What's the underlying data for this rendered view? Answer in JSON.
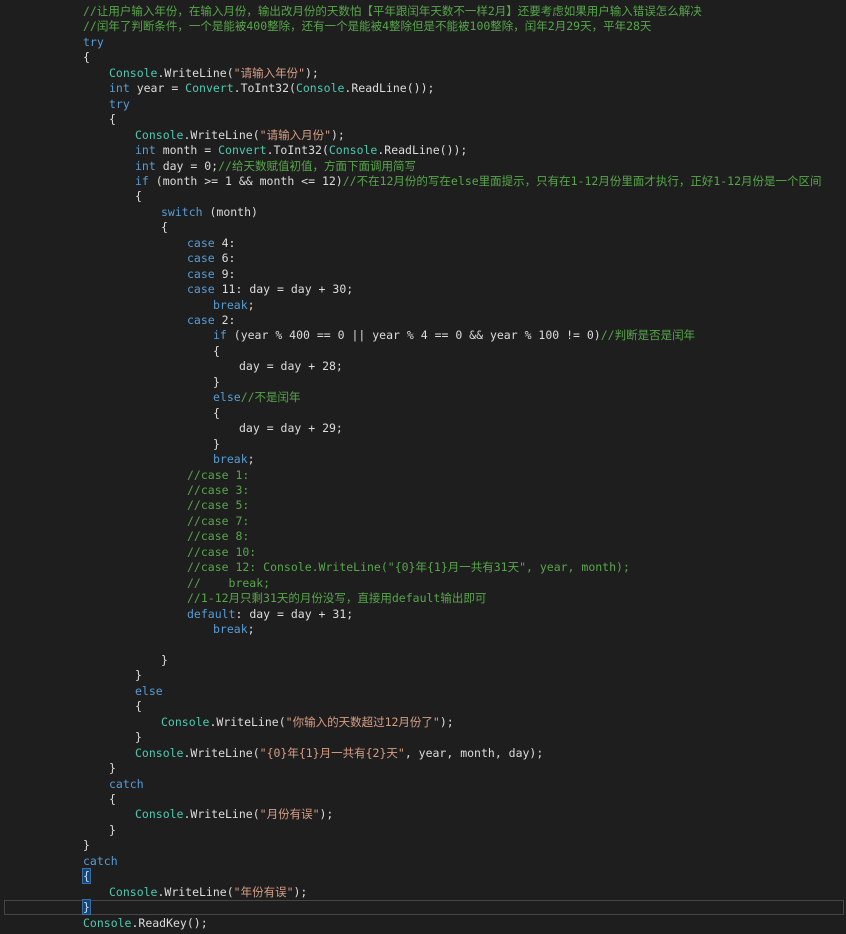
{
  "editor": {
    "colors": {
      "background": "#1e1e1e",
      "keyword": "#569cd6",
      "string": "#d69d85",
      "comment": "#57a64a",
      "type": "#4ec9b0",
      "text": "#dcdcdc",
      "brace_highlight": "#0e4583",
      "current_line_border": "#464646"
    },
    "lines": [
      {
        "indent": 12,
        "tokens": [
          {
            "t": "cm",
            "v": "//让用户输入年份，在输入月份，输出改月份的天数怕【平年跟闰年天数不一样2月】还要考虑如果用户输入错误怎么解决"
          }
        ]
      },
      {
        "indent": 12,
        "tokens": [
          {
            "t": "cm",
            "v": "//闰年了判断条件，一个是能被400整除，还有一个是能被4整除但是不能被100整除，闰年2月29天，平年28天"
          }
        ]
      },
      {
        "indent": 12,
        "tokens": [
          {
            "t": "kw",
            "v": "try"
          }
        ]
      },
      {
        "indent": 12,
        "tokens": [
          {
            "t": "pl",
            "v": "{"
          }
        ]
      },
      {
        "indent": 16,
        "tokens": [
          {
            "t": "ty",
            "v": "Console"
          },
          {
            "t": "pl",
            "v": ".WriteLine("
          },
          {
            "t": "str",
            "v": "\"请输入年份\""
          },
          {
            "t": "pl",
            "v": ");"
          }
        ]
      },
      {
        "indent": 16,
        "tokens": [
          {
            "t": "kw",
            "v": "int"
          },
          {
            "t": "pl",
            "v": " year = "
          },
          {
            "t": "ty",
            "v": "Convert"
          },
          {
            "t": "pl",
            "v": ".ToInt32("
          },
          {
            "t": "ty",
            "v": "Console"
          },
          {
            "t": "pl",
            "v": ".ReadLine());"
          }
        ]
      },
      {
        "indent": 16,
        "tokens": [
          {
            "t": "kw",
            "v": "try"
          }
        ]
      },
      {
        "indent": 16,
        "tokens": [
          {
            "t": "pl",
            "v": "{"
          }
        ]
      },
      {
        "indent": 20,
        "tokens": [
          {
            "t": "ty",
            "v": "Console"
          },
          {
            "t": "pl",
            "v": ".WriteLine("
          },
          {
            "t": "str",
            "v": "\"请输入月份\""
          },
          {
            "t": "pl",
            "v": ");"
          }
        ]
      },
      {
        "indent": 20,
        "tokens": [
          {
            "t": "kw",
            "v": "int"
          },
          {
            "t": "pl",
            "v": " month = "
          },
          {
            "t": "ty",
            "v": "Convert"
          },
          {
            "t": "pl",
            "v": ".ToInt32("
          },
          {
            "t": "ty",
            "v": "Console"
          },
          {
            "t": "pl",
            "v": ".ReadLine());"
          }
        ]
      },
      {
        "indent": 20,
        "tokens": [
          {
            "t": "kw",
            "v": "int"
          },
          {
            "t": "pl",
            "v": " day = 0;"
          },
          {
            "t": "cm",
            "v": "//给天数赋值初值，方面下面调用简写"
          }
        ]
      },
      {
        "indent": 20,
        "tokens": [
          {
            "t": "kw",
            "v": "if"
          },
          {
            "t": "pl",
            "v": " (month >= 1 && month <= 12)"
          },
          {
            "t": "cm",
            "v": "//不在12月份的写在else里面提示，只有在1-12月份里面才执行，正好1-12月份是一个区间"
          }
        ]
      },
      {
        "indent": 20,
        "tokens": [
          {
            "t": "pl",
            "v": "{"
          }
        ]
      },
      {
        "indent": 24,
        "tokens": [
          {
            "t": "kw",
            "v": "switch"
          },
          {
            "t": "pl",
            "v": " (month)"
          }
        ]
      },
      {
        "indent": 24,
        "tokens": [
          {
            "t": "pl",
            "v": "{"
          }
        ]
      },
      {
        "indent": 28,
        "tokens": [
          {
            "t": "kw",
            "v": "case"
          },
          {
            "t": "pl",
            "v": " 4:"
          }
        ]
      },
      {
        "indent": 28,
        "tokens": [
          {
            "t": "kw",
            "v": "case"
          },
          {
            "t": "pl",
            "v": " 6:"
          }
        ]
      },
      {
        "indent": 28,
        "tokens": [
          {
            "t": "kw",
            "v": "case"
          },
          {
            "t": "pl",
            "v": " 9:"
          }
        ]
      },
      {
        "indent": 28,
        "tokens": [
          {
            "t": "kw",
            "v": "case"
          },
          {
            "t": "pl",
            "v": " 11: day = day + 30;"
          }
        ]
      },
      {
        "indent": 32,
        "tokens": [
          {
            "t": "kw",
            "v": "break"
          },
          {
            "t": "pl",
            "v": ";"
          }
        ]
      },
      {
        "indent": 28,
        "tokens": [
          {
            "t": "kw",
            "v": "case"
          },
          {
            "t": "pl",
            "v": " 2:"
          }
        ]
      },
      {
        "indent": 32,
        "tokens": [
          {
            "t": "kw",
            "v": "if"
          },
          {
            "t": "pl",
            "v": " (year % 400 == 0 || year % 4 == 0 && year % 100 != 0)"
          },
          {
            "t": "cm",
            "v": "//判断是否是闰年"
          }
        ]
      },
      {
        "indent": 32,
        "tokens": [
          {
            "t": "pl",
            "v": "{"
          }
        ]
      },
      {
        "indent": 36,
        "tokens": [
          {
            "t": "pl",
            "v": "day = day + 28;"
          }
        ]
      },
      {
        "indent": 32,
        "tokens": [
          {
            "t": "pl",
            "v": "}"
          }
        ]
      },
      {
        "indent": 32,
        "tokens": [
          {
            "t": "kw",
            "v": "else"
          },
          {
            "t": "cm",
            "v": "//不是闰年"
          }
        ]
      },
      {
        "indent": 32,
        "tokens": [
          {
            "t": "pl",
            "v": "{"
          }
        ]
      },
      {
        "indent": 36,
        "tokens": [
          {
            "t": "pl",
            "v": "day = day + 29;"
          }
        ]
      },
      {
        "indent": 32,
        "tokens": [
          {
            "t": "pl",
            "v": "}"
          }
        ]
      },
      {
        "indent": 32,
        "tokens": [
          {
            "t": "kw",
            "v": "break"
          },
          {
            "t": "pl",
            "v": ";"
          }
        ]
      },
      {
        "indent": 28,
        "tokens": [
          {
            "t": "cm",
            "v": "//case 1:"
          }
        ]
      },
      {
        "indent": 28,
        "tokens": [
          {
            "t": "cm",
            "v": "//case 3:"
          }
        ]
      },
      {
        "indent": 28,
        "tokens": [
          {
            "t": "cm",
            "v": "//case 5:"
          }
        ]
      },
      {
        "indent": 28,
        "tokens": [
          {
            "t": "cm",
            "v": "//case 7:"
          }
        ]
      },
      {
        "indent": 28,
        "tokens": [
          {
            "t": "cm",
            "v": "//case 8:"
          }
        ]
      },
      {
        "indent": 28,
        "tokens": [
          {
            "t": "cm",
            "v": "//case 10:"
          }
        ]
      },
      {
        "indent": 28,
        "tokens": [
          {
            "t": "cm",
            "v": "//case 12: Console.WriteLine(\"{0}年{1}月一共有31天\", year, month);"
          }
        ]
      },
      {
        "indent": 28,
        "tokens": [
          {
            "t": "cm",
            "v": "//    break;"
          }
        ]
      },
      {
        "indent": 28,
        "tokens": [
          {
            "t": "cm",
            "v": "//1-12月只剩31天的月份没写，直接用default输出即可"
          }
        ]
      },
      {
        "indent": 28,
        "tokens": [
          {
            "t": "kw",
            "v": "default"
          },
          {
            "t": "pl",
            "v": ": day = day + 31;"
          }
        ]
      },
      {
        "indent": 32,
        "tokens": [
          {
            "t": "kw",
            "v": "break"
          },
          {
            "t": "pl",
            "v": ";"
          }
        ]
      },
      {
        "indent": 0,
        "tokens": []
      },
      {
        "indent": 24,
        "tokens": [
          {
            "t": "pl",
            "v": "}"
          }
        ]
      },
      {
        "indent": 20,
        "tokens": [
          {
            "t": "pl",
            "v": "}"
          }
        ]
      },
      {
        "indent": 20,
        "tokens": [
          {
            "t": "kw",
            "v": "else"
          }
        ]
      },
      {
        "indent": 20,
        "tokens": [
          {
            "t": "pl",
            "v": "{"
          }
        ]
      },
      {
        "indent": 24,
        "tokens": [
          {
            "t": "ty",
            "v": "Console"
          },
          {
            "t": "pl",
            "v": ".WriteLine("
          },
          {
            "t": "str",
            "v": "\"你输入的天数超过12月份了\""
          },
          {
            "t": "pl",
            "v": ");"
          }
        ]
      },
      {
        "indent": 20,
        "tokens": [
          {
            "t": "pl",
            "v": "}"
          }
        ]
      },
      {
        "indent": 20,
        "tokens": [
          {
            "t": "ty",
            "v": "Console"
          },
          {
            "t": "pl",
            "v": ".WriteLine("
          },
          {
            "t": "str",
            "v": "\"{0}年{1}月一共有{2}天\""
          },
          {
            "t": "pl",
            "v": ", year, month, day);"
          }
        ]
      },
      {
        "indent": 16,
        "tokens": [
          {
            "t": "pl",
            "v": "}"
          }
        ]
      },
      {
        "indent": 16,
        "tokens": [
          {
            "t": "kw",
            "v": "catch"
          }
        ]
      },
      {
        "indent": 16,
        "tokens": [
          {
            "t": "pl",
            "v": "{"
          }
        ]
      },
      {
        "indent": 20,
        "tokens": [
          {
            "t": "ty",
            "v": "Console"
          },
          {
            "t": "pl",
            "v": ".WriteLine("
          },
          {
            "t": "str",
            "v": "\"月份有误\""
          },
          {
            "t": "pl",
            "v": ");"
          }
        ]
      },
      {
        "indent": 16,
        "tokens": [
          {
            "t": "pl",
            "v": "}"
          }
        ]
      },
      {
        "indent": 12,
        "tokens": [
          {
            "t": "pl",
            "v": "}"
          }
        ]
      },
      {
        "indent": 12,
        "tokens": [
          {
            "t": "kw",
            "v": "catch"
          }
        ]
      },
      {
        "indent": 12,
        "tokens": [
          {
            "t": "hl",
            "v": "{"
          }
        ]
      },
      {
        "indent": 16,
        "tokens": [
          {
            "t": "ty",
            "v": "Console"
          },
          {
            "t": "pl",
            "v": ".WriteLine("
          },
          {
            "t": "str",
            "v": "\"年份有误\""
          },
          {
            "t": "pl",
            "v": ");"
          }
        ]
      },
      {
        "indent": 12,
        "tokens": [
          {
            "t": "hl",
            "v": "}"
          }
        ]
      },
      {
        "indent": 12,
        "tokens": [
          {
            "t": "ty",
            "v": "Console"
          },
          {
            "t": "pl",
            "v": ".ReadKey();"
          }
        ]
      }
    ]
  }
}
